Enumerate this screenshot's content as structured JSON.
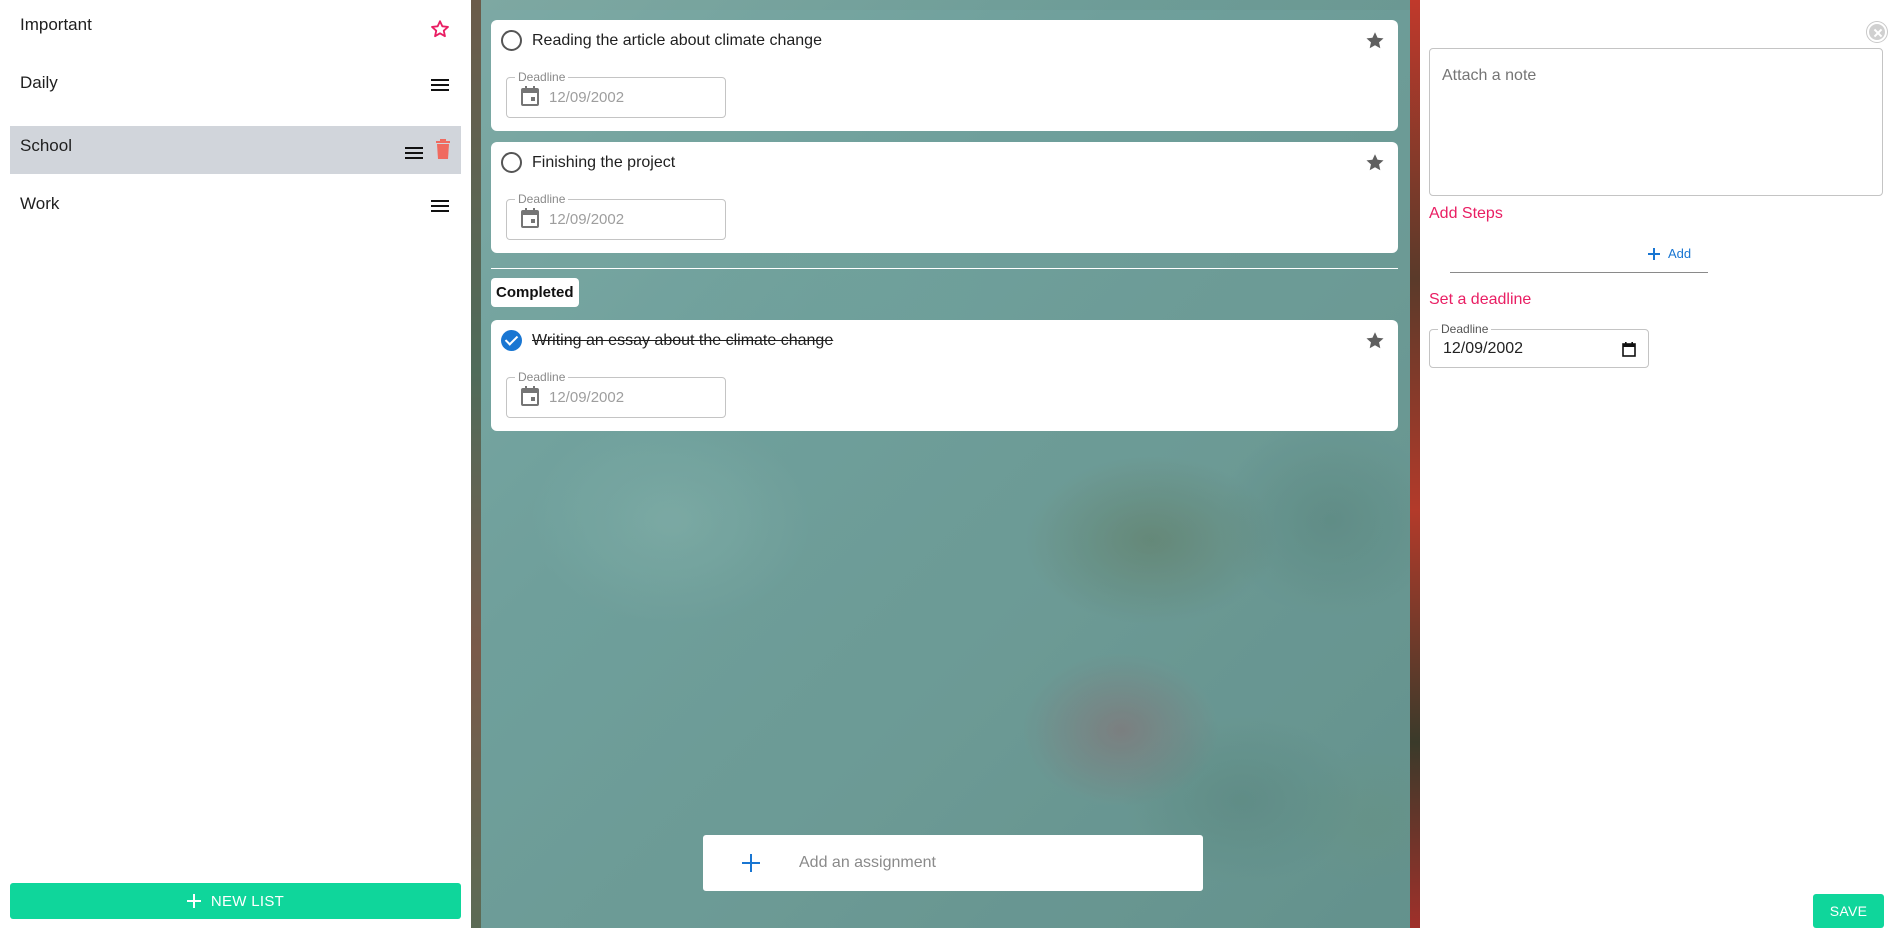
{
  "sidebar": {
    "lists": [
      {
        "label": "Important",
        "icon": "star-outline-icon"
      },
      {
        "label": "Daily",
        "icon": "menu-icon"
      },
      {
        "label": "School",
        "icon": "menu-icon",
        "selected": true
      },
      {
        "label": "Work",
        "icon": "menu-icon"
      }
    ],
    "new_list_label": "NEW LIST"
  },
  "main": {
    "tasks": [
      {
        "title": "Reading the article about climate change",
        "completed": false,
        "deadline_legend": "Deadline",
        "deadline": "12/09/2002"
      },
      {
        "title": "Finishing the project",
        "completed": false,
        "deadline_legend": "Deadline",
        "deadline": "12/09/2002"
      }
    ],
    "completed_label": "Completed",
    "completed_tasks": [
      {
        "title": "Writing an essay about the climate change",
        "completed": true,
        "deadline_legend": "Deadline",
        "deadline": "12/09/2002"
      }
    ],
    "add_assignment_placeholder": "Add an assignment"
  },
  "detail": {
    "note_placeholder": "Attach a note",
    "add_steps_title": "Add Steps",
    "add_step_label": "Add",
    "set_deadline_title": "Set a deadline",
    "deadline_legend": "Deadline",
    "deadline_value": "12/09/2002",
    "save_label": "SAVE"
  },
  "colors": {
    "accent_green": "#0fd69b",
    "accent_pink": "#e91e63",
    "check_blue": "#1976d2",
    "selected_bg": "#d1d5db",
    "delete_red": "#f06a5f"
  }
}
